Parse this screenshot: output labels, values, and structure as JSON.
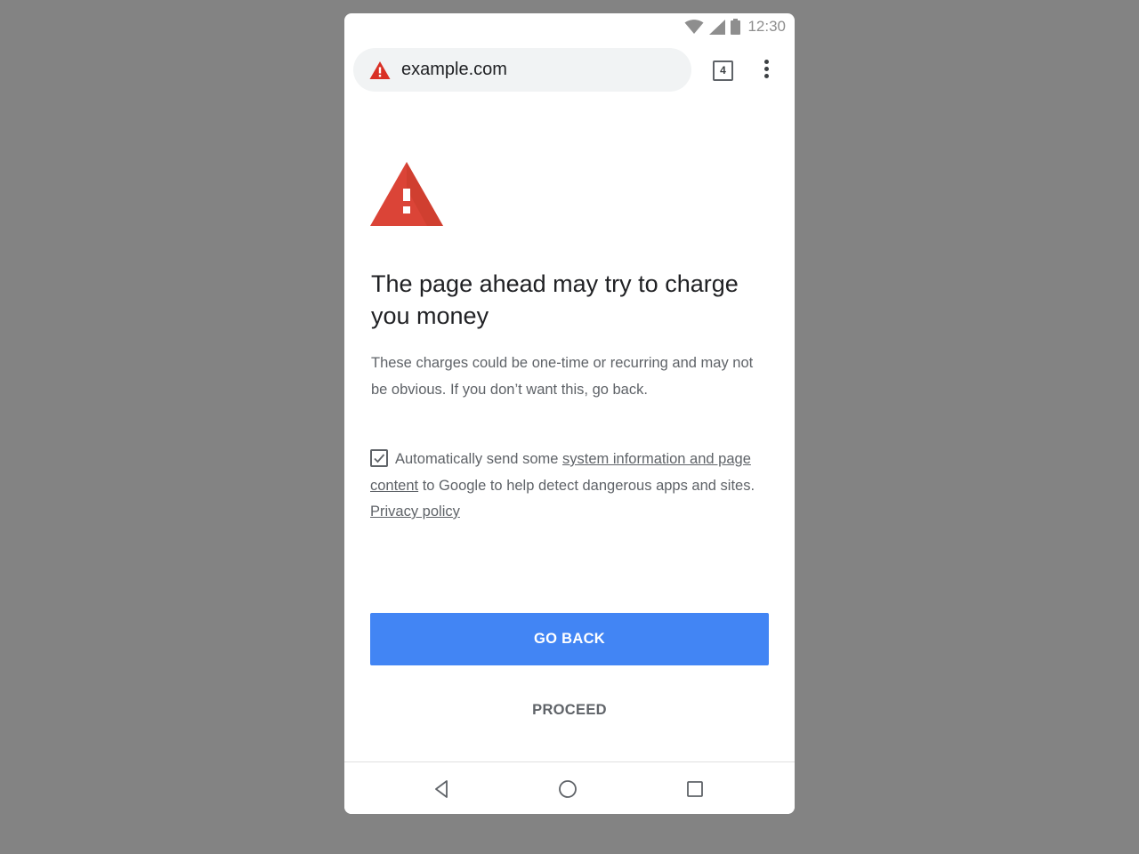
{
  "status_bar": {
    "time": "12:30",
    "icons": [
      "wifi-icon",
      "cell-signal-icon",
      "battery-icon"
    ]
  },
  "toolbar": {
    "security_icon": "warning-triangle-icon",
    "url": "example.com",
    "tab_count": "4",
    "menu_icon": "more-vert-icon"
  },
  "interstitial": {
    "hero_icon": "warning-triangle-icon",
    "heading": "The page ahead may try to charge you money",
    "body": "These charges could be one-time or recurring and may not be obvious. If you don’t want this, go back.",
    "optin": {
      "checked": true,
      "prefix": "Automatically send some ",
      "link_text": "system information and page content",
      "middle": " to Google to help detect dangerous apps and sites. ",
      "privacy_link": "Privacy policy"
    },
    "primary_button": "GO BACK",
    "secondary_button": "PROCEED"
  },
  "nav_bar": {
    "buttons": [
      "back-icon",
      "home-icon",
      "recents-icon"
    ]
  },
  "colors": {
    "background": "#838383",
    "primary_button": "#4285f4",
    "warning_red": "#d93025",
    "text_primary": "#202124",
    "text_secondary": "#5f6368",
    "omnibox": "#f1f3f4"
  }
}
